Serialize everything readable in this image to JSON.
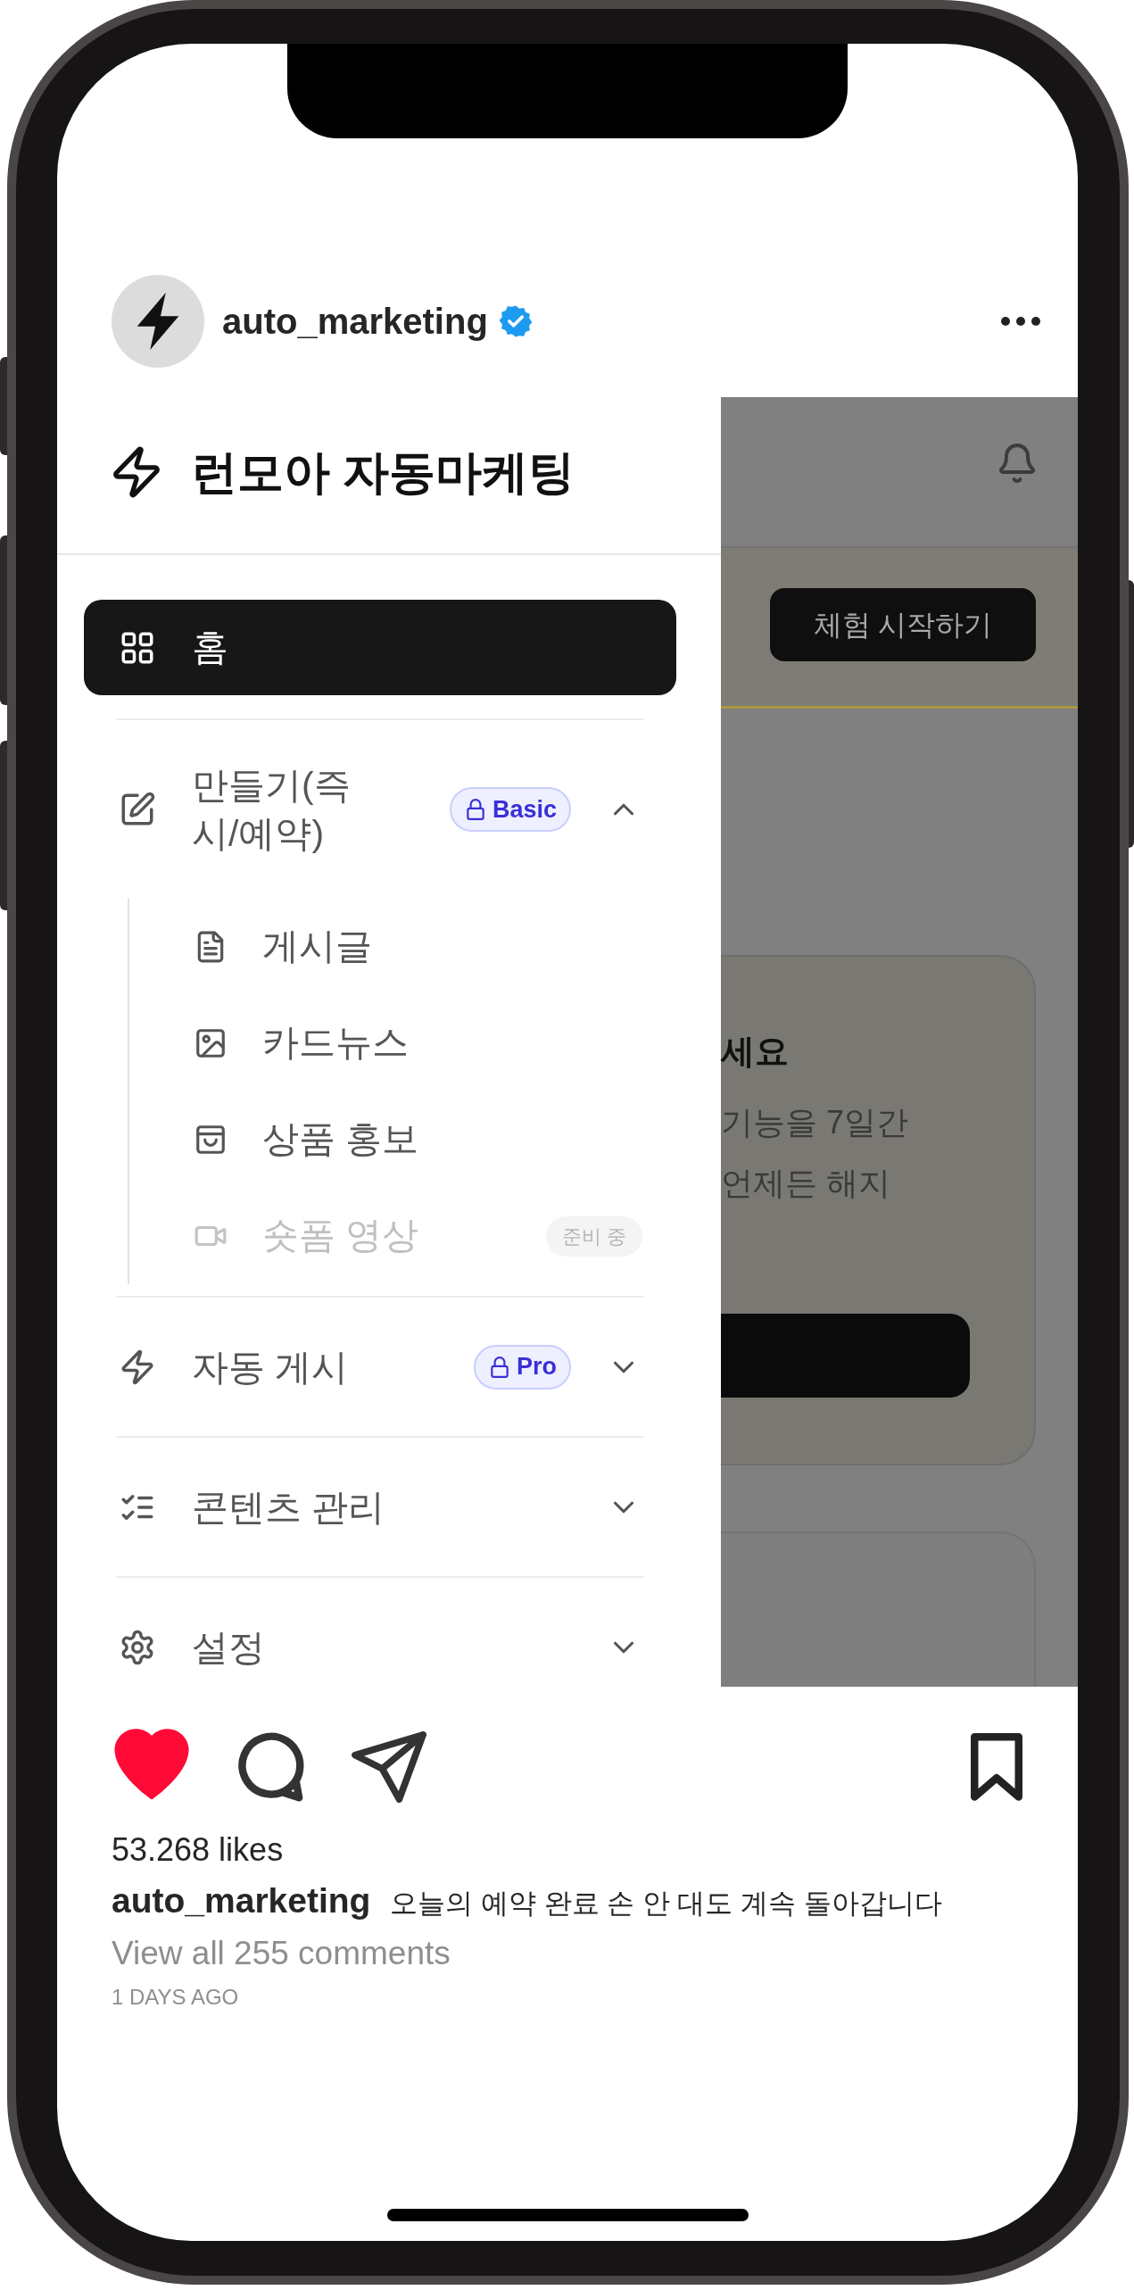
{
  "post": {
    "username": "auto_marketing",
    "verified": true
  },
  "app": {
    "title": "런모아 자동마케팅",
    "nav": [
      {
        "kind": "link",
        "label": "홈",
        "selected": true
      },
      {
        "kind": "group",
        "label": "만들기(즉시/예약)",
        "badge": "Basic",
        "expanded": true,
        "selected": false,
        "children": [
          {
            "label": "게시글",
            "selected": false,
            "disabled": false
          },
          {
            "label": "카드뉴스",
            "selected": false,
            "disabled": false
          },
          {
            "label": "상품 홍보",
            "selected": false,
            "disabled": false
          },
          {
            "label": "숏폼 영상",
            "selected": false,
            "disabled": true,
            "tag": "준비 중"
          }
        ]
      },
      {
        "kind": "group",
        "label": "자동 게시",
        "badge": "Pro",
        "expanded": false,
        "selected": false
      },
      {
        "kind": "group",
        "label": "콘텐츠 관리",
        "expanded": false,
        "selected": false
      },
      {
        "kind": "group",
        "label": "설정",
        "expanded": false,
        "selected": false
      }
    ],
    "background": {
      "trial_button": "체험 시작하기",
      "card_lines": [
        "세요",
        "기능을 7일간",
        "언제든 해지"
      ]
    }
  },
  "actions": {
    "liked": true
  },
  "likes": "53.268 likes",
  "caption": {
    "username": "auto_marketing",
    "text": "오늘의 예약 완료 손 안 대도 계속 돌아갑니다"
  },
  "comments_link": "View all 255 comments",
  "time": "1 DAYS AGO"
}
